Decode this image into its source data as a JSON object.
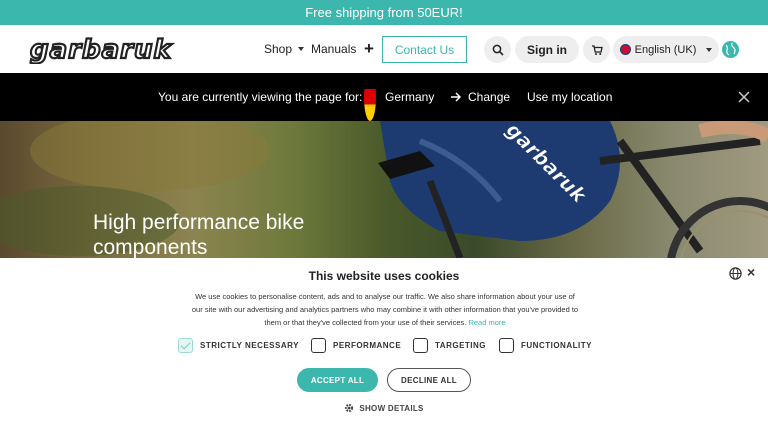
{
  "promo": {
    "text": "Free shipping from 50EUR!"
  },
  "header": {
    "logo_text": "garbaruk",
    "nav": [
      {
        "label": "Shop",
        "has_dropdown": true
      },
      {
        "label": "Manuals",
        "has_dropdown": false
      }
    ],
    "plus_icon": "plus-icon",
    "contact_label": "Contact Us",
    "search_icon": "search-icon",
    "signin_label": "Sign in",
    "cart_icon": "cart-icon",
    "language": "English (UK)",
    "globe_icon": "globe-icon"
  },
  "geo_bar": {
    "prefix": "You are currently viewing the page for:",
    "country": "Germany",
    "change_label": "Change",
    "location_label": "Use my location",
    "close_icon": "close-icon"
  },
  "hero": {
    "title": "High performance bike components",
    "shorts_text": "garbaruk"
  },
  "cookie_banner": {
    "title": "This website uses cookies",
    "text": "We use cookies to personalise content, ads and to analyse our traffic. We also share information about your use of our site with our advertising and analytics partners who may combine it with other information that you've provided to them or that they've collected from your use of their services.",
    "read_more": "Read more",
    "checkboxes": [
      {
        "label": "STRICTLY NECESSARY",
        "checked": true
      },
      {
        "label": "PERFORMANCE",
        "checked": false
      },
      {
        "label": "TARGETING",
        "checked": false
      },
      {
        "label": "FUNCTIONALITY",
        "checked": false
      }
    ],
    "accept_label": "ACCEPT ALL",
    "decline_label": "DECLINE ALL",
    "details_label": "SHOW DETAILS"
  },
  "colors": {
    "accent": "#3bb7ad",
    "geo_bar": "#000000"
  }
}
